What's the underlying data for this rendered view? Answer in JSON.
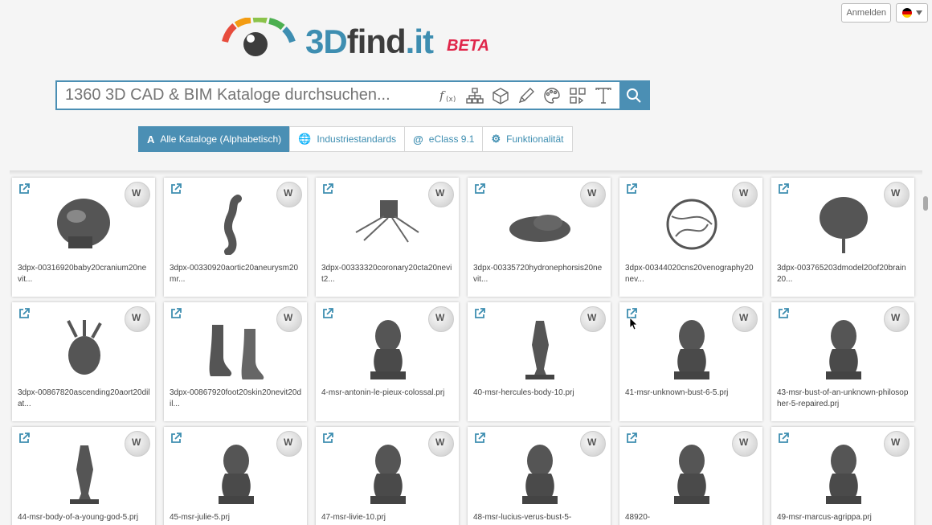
{
  "header": {
    "login_label": "Anmelden",
    "lang_icon": "german-flag-icon"
  },
  "logo": {
    "brand_3d": "3D",
    "brand_find": "find",
    "brand_it": ".it",
    "badge": "BETA"
  },
  "search": {
    "placeholder": "1360 3D CAD & BIM Kataloge durchsuchen...",
    "tools": [
      "formula-icon",
      "hierarchy-icon",
      "cube-icon",
      "pencil-icon",
      "palette-icon",
      "shapes-icon",
      "text-icon"
    ],
    "tool_glyphs": [
      "f(x)",
      "⛙",
      "⬡",
      "✎",
      "🎨",
      "⧉",
      "T"
    ]
  },
  "tabs": [
    {
      "label": "Alle Kataloge (Alphabetisch)",
      "icon": "A",
      "active": true
    },
    {
      "label": "Industriestandards",
      "icon": "🌐",
      "active": false
    },
    {
      "label": "eClass 9.1",
      "icon": "@",
      "active": false
    },
    {
      "label": "Funktionalität",
      "icon": "⚙",
      "active": false
    }
  ],
  "cards": [
    {
      "title": "3dpx-00316920baby20cranium20nevit..."
    },
    {
      "title": "3dpx-00330920aortic20aneurysm20mr..."
    },
    {
      "title": "3dpx-00333320coronary20cta20nevit2..."
    },
    {
      "title": "3dpx-00335720hydronephorsis20nevit..."
    },
    {
      "title": "3dpx-00344020cns20venography20nev..."
    },
    {
      "title": "3dpx-003765203dmodel20of20brain20..."
    },
    {
      "title": "3dpx-00867820ascending20aort20dilat..."
    },
    {
      "title": "3dpx-00867920foot20skin20nevit20dil..."
    },
    {
      "title": "4-msr-antonin-le-pieux-colossal.prj"
    },
    {
      "title": "40-msr-hercules-body-10.prj"
    },
    {
      "title": "41-msr-unknown-bust-6-5.prj"
    },
    {
      "title": "43-msr-bust-of-an-unknown-philosopher-5-repaired.prj"
    },
    {
      "title": "44-msr-body-of-a-young-god-5.prj"
    },
    {
      "title": "45-msr-julie-5.prj"
    },
    {
      "title": "47-msr-livie-10.prj"
    },
    {
      "title": "48-msr-lucius-verus-bust-5-"
    },
    {
      "title": "48920-"
    },
    {
      "title": "49-msr-marcus-agrippa.prj"
    }
  ],
  "colors": {
    "accent": "#4b8fb4",
    "beta": "#e0264a"
  }
}
